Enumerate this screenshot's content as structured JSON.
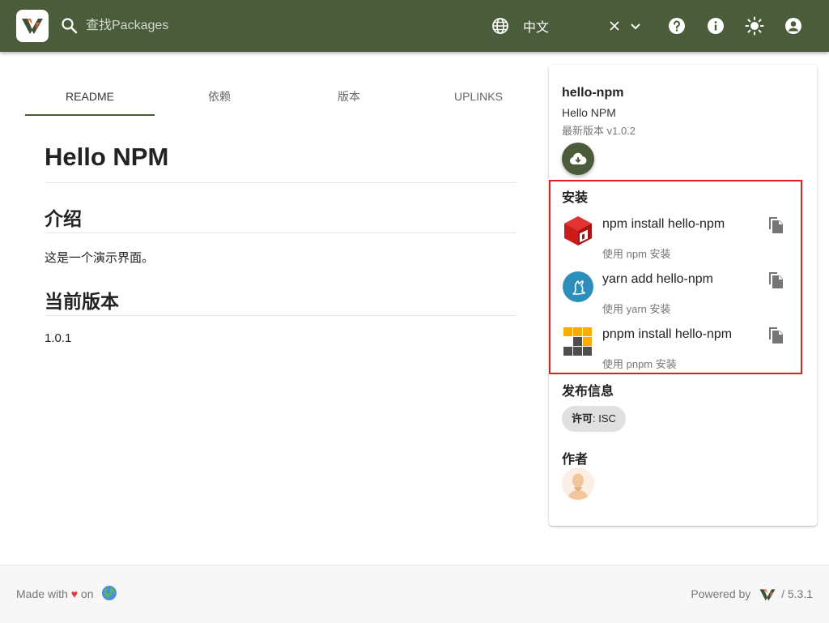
{
  "header": {
    "search_placeholder": "查找Packages",
    "language": "中文",
    "icons": [
      "search-icon",
      "globe-icon",
      "close-icon",
      "chevron-down-icon",
      "help-icon",
      "info-icon",
      "brightness-icon",
      "account-icon"
    ],
    "color": "#4a5c3a"
  },
  "tabs": [
    {
      "label": "README",
      "active": true
    },
    {
      "label": "依赖",
      "active": false
    },
    {
      "label": "版本",
      "active": false
    },
    {
      "label": "UPLINKS",
      "active": false
    }
  ],
  "readme": {
    "title": "Hello NPM",
    "intro_heading": "介绍",
    "intro_text": "这是一个演示界面。",
    "version_heading": "当前版本",
    "version_text": "1.0.1"
  },
  "package": {
    "name": "hello-npm",
    "description": "Hello NPM",
    "latest": "最新版本 v1.0.2"
  },
  "install": {
    "title": "安装",
    "items": [
      {
        "cmd": "npm install hello-npm",
        "sub": "使用 npm 安装",
        "icon": "npm-icon"
      },
      {
        "cmd": "yarn add hello-npm",
        "sub": "使用 yarn 安装",
        "icon": "yarn-icon"
      },
      {
        "cmd": "pnpm install hello-npm",
        "sub": "使用 pnpm 安装",
        "icon": "pnpm-icon"
      }
    ]
  },
  "release": {
    "title": "发布信息",
    "license_label": "许可",
    "license_value": ": ISC"
  },
  "author": {
    "title": "作者"
  },
  "footer": {
    "made_with": "Made with",
    "heart": "♥",
    "on": "on",
    "powered_by": "Powered by",
    "version": "/ 5.3.1"
  },
  "colors": {
    "highlight": "#e02020",
    "header": "#4a5c3a"
  }
}
